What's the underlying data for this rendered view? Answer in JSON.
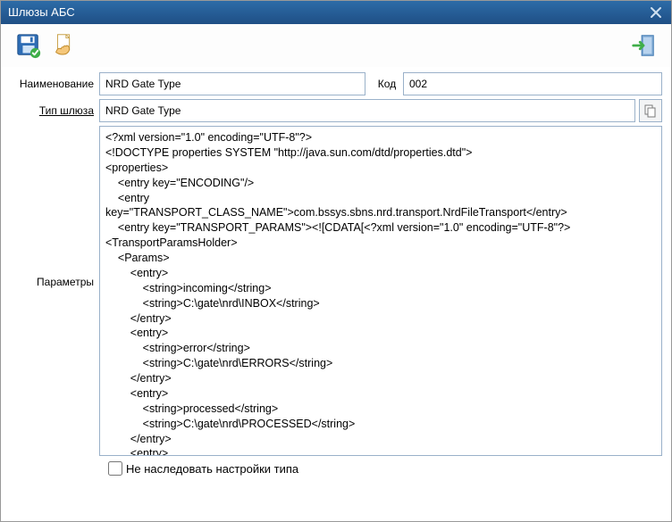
{
  "window": {
    "title": "Шлюзы АБС"
  },
  "toolbar": {
    "save_icon": "save-floppy",
    "hand_icon": "hand-document",
    "exit_icon": "exit-door"
  },
  "labels": {
    "name": "Наименование",
    "code": "Код",
    "gateway_type": "Тип шлюза",
    "params": "Параметры",
    "inherit": "Не наследовать настройки типа",
    "copy_icon": "copy"
  },
  "fields": {
    "name": "NRD Gate Type",
    "code": "002",
    "gateway_type": "NRD Gate Type",
    "inherit_checked": false,
    "params_xml": "<?xml version=\"1.0\" encoding=\"UTF-8\"?>\n<!DOCTYPE properties SYSTEM \"http://java.sun.com/dtd/properties.dtd\">\n<properties>\n    <entry key=\"ENCODING\"/>\n    <entry\nkey=\"TRANSPORT_CLASS_NAME\">com.bssys.sbns.nrd.transport.NrdFileTransport</entry>\n    <entry key=\"TRANSPORT_PARAMS\"><![CDATA[<?xml version=\"1.0\" encoding=\"UTF-8\"?>\n<TransportParamsHolder>\n    <Params>\n        <entry>\n            <string>incoming</string>\n            <string>C:\\gate\\nrd\\INBOX</string>\n        </entry>\n        <entry>\n            <string>error</string>\n            <string>C:\\gate\\nrd\\ERRORS</string>\n        </entry>\n        <entry>\n            <string>processed</string>\n            <string>C:\\gate\\nrd\\PROCESSED</string>\n        </entry>\n        <entry>"
  }
}
